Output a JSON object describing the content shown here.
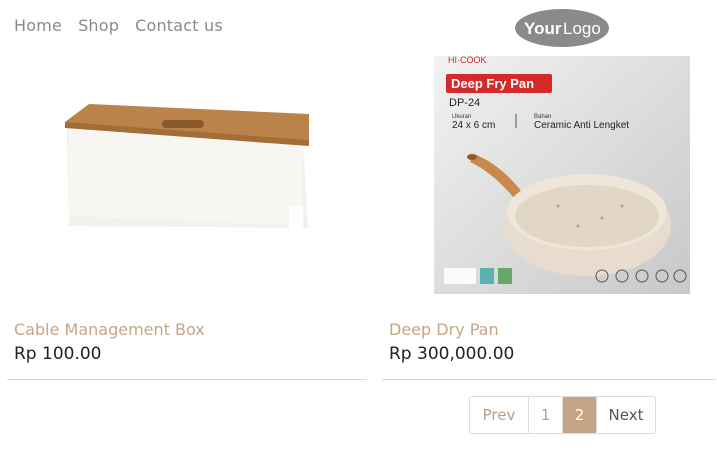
{
  "nav": {
    "items": [
      "Home",
      "Shop",
      "Contact us"
    ]
  },
  "logo": {
    "text_bold": "Your",
    "text_light": "Logo"
  },
  "products": [
    {
      "name": "Cable Management Box",
      "price": "Rp 100.00"
    },
    {
      "name": "Deep Dry Pan",
      "price": "Rp 300,000.00",
      "image_text": {
        "brand": "HI·COOK",
        "title": "Deep Fry Pan",
        "code": "DP-24",
        "size_label": "Ukuran",
        "size_value": "24 x 6 cm",
        "material_label": "Bahan",
        "material_value": "Ceramic Anti Lengket"
      }
    }
  ],
  "pagination": {
    "prev": "Prev",
    "pages": [
      "1",
      "2"
    ],
    "active": "2",
    "next": "Next"
  },
  "colors": {
    "accent": "#c5a585",
    "text": "#222222",
    "nav": "#8a8a8a",
    "badge": "#d42a2a"
  }
}
